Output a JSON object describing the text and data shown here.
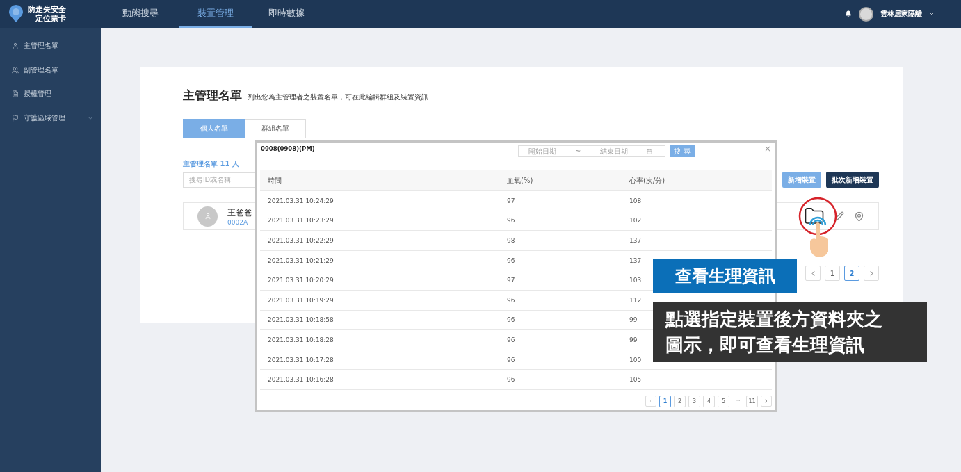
{
  "topbar": {
    "logo_line1": "防走失安全",
    "logo_line2": "定位票卡",
    "nav": [
      {
        "label": "動態搜尋",
        "selected": false
      },
      {
        "label": "裝置管理",
        "selected": true
      },
      {
        "label": "即時數據",
        "selected": false
      }
    ],
    "user": "雲林居家隔離"
  },
  "sidebar": {
    "items": [
      {
        "label": "主管理名單",
        "kind": "person",
        "expandable": false
      },
      {
        "label": "副管理名單",
        "kind": "people",
        "expandable": false
      },
      {
        "label": "授權管理",
        "kind": "doc",
        "expandable": false
      },
      {
        "label": "守護區域管理",
        "kind": "flag",
        "expandable": true
      }
    ]
  },
  "page": {
    "title": "主管理名單",
    "subtitle": "列出您為主管理者之裝置名單，可在此編輯群組及裝置資訊",
    "tabs": [
      {
        "label": "個人名單",
        "selected": true
      },
      {
        "label": "群組名單",
        "selected": false
      }
    ],
    "count": "主管理名單 11 人",
    "search": {
      "placeholder": "搜尋ID或名稱"
    },
    "buttons": [
      {
        "label": "新增裝置",
        "kind": "light"
      },
      {
        "label": "批次新增裝置",
        "kind": "dark"
      }
    ],
    "devices": [
      {
        "name": "王爸爸",
        "id": "0002A"
      }
    ],
    "pagination": [
      {
        "label": "1",
        "selected": false
      },
      {
        "label": "2",
        "selected": true
      }
    ]
  },
  "modal": {
    "title": "0908(0908)(PM)",
    "start_placeholder": "開始日期",
    "separator": "~",
    "end_placeholder": "結束日期",
    "search_button": "搜 尋",
    "close": "×",
    "columns": [
      "時間",
      "血氧(%)",
      "心率(次/分)"
    ],
    "rows": [
      [
        "2021.03.31 10:24:29",
        "97",
        "108"
      ],
      [
        "2021.03.31 10:23:29",
        "96",
        "102"
      ],
      [
        "2021.03.31 10:22:29",
        "98",
        "137"
      ],
      [
        "2021.03.31 10:21:29",
        "96",
        "137"
      ],
      [
        "2021.03.31 10:20:29",
        "97",
        "103"
      ],
      [
        "2021.03.31 10:19:29",
        "96",
        "112"
      ],
      [
        "2021.03.31 10:18:58",
        "96",
        "99"
      ],
      [
        "2021.03.31 10:18:28",
        "96",
        "99"
      ],
      [
        "2021.03.31 10:17:28",
        "96",
        "100"
      ],
      [
        "2021.03.31 10:16:28",
        "96",
        "105"
      ]
    ],
    "pagination": [
      {
        "label": "1",
        "selected": true
      },
      {
        "label": "2",
        "selected": false
      },
      {
        "label": "3",
        "selected": false
      },
      {
        "label": "4",
        "selected": false
      },
      {
        "label": "5",
        "selected": false
      },
      {
        "label": "···",
        "kind": "ellipsis"
      },
      {
        "label": "11",
        "selected": false
      }
    ]
  },
  "callouts": {
    "heading": "查看生理資訊",
    "body": "點選指定裝置後方資料夾之圖示，即可查看生理資訊"
  }
}
